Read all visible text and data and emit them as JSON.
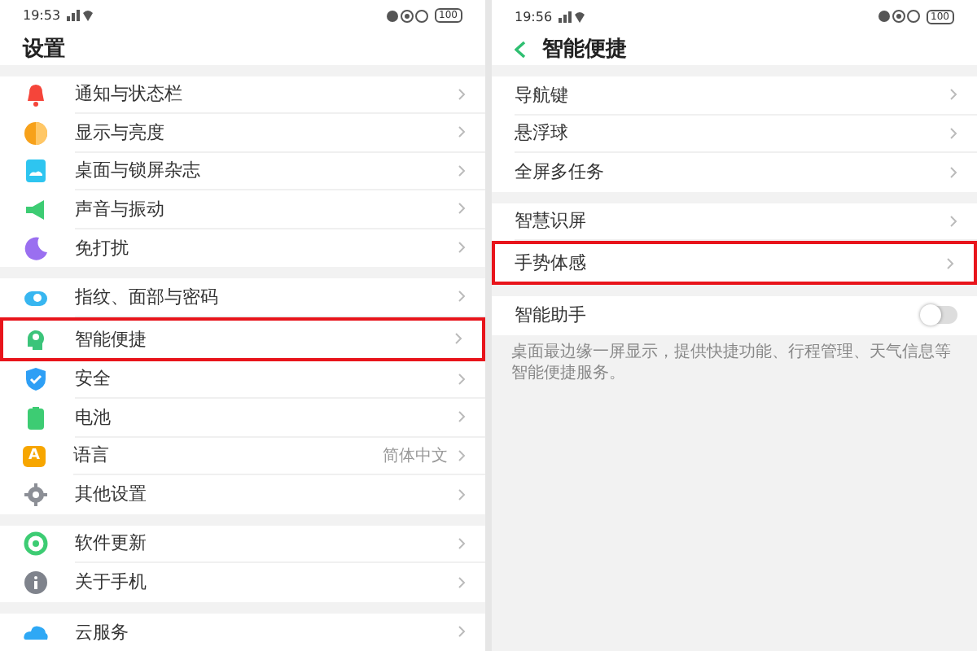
{
  "screens": [
    {
      "status_bar": {
        "time": "19:53",
        "battery": "100"
      },
      "title": "设置",
      "back": false,
      "groups": [
        {
          "items": [
            {
              "kind": "icon-row",
              "label": "通知与状态栏",
              "highlighted": false
            },
            {
              "kind": "icon-row",
              "label": "显示与亮度",
              "highlighted": false
            },
            {
              "kind": "icon-row",
              "label": "桌面与锁屏杂志",
              "highlighted": false
            },
            {
              "kind": "icon-row",
              "label": "声音与振动",
              "highlighted": false
            },
            {
              "kind": "icon-row",
              "label": "免打扰",
              "highlighted": false
            }
          ]
        },
        {
          "items": [
            {
              "kind": "icon-row",
              "label": "指纹、面部与密码",
              "highlighted": false
            },
            {
              "kind": "icon-row",
              "label": "智能便捷",
              "highlighted": true
            },
            {
              "kind": "icon-row",
              "label": "安全",
              "highlighted": false
            },
            {
              "kind": "icon-row",
              "label": "电池",
              "highlighted": false
            },
            {
              "kind": "icon-row",
              "label": "语言",
              "highlighted": false,
              "badge": "A",
              "value": "简体中文"
            },
            {
              "kind": "icon-row",
              "label": "其他设置",
              "highlighted": false
            }
          ]
        },
        {
          "items": [
            {
              "kind": "icon-row",
              "label": "软件更新",
              "highlighted": false
            },
            {
              "kind": "icon-row",
              "label": "关于手机",
              "highlighted": false
            }
          ]
        },
        {
          "items": [
            {
              "kind": "icon-row",
              "label": "云服务",
              "highlighted": false
            }
          ]
        }
      ]
    },
    {
      "status_bar": {
        "time": "19:56",
        "battery": "100"
      },
      "title": "智能便捷",
      "back": true,
      "groups": [
        {
          "items": [
            {
              "kind": "row",
              "label": "导航键",
              "highlighted": false
            },
            {
              "kind": "row",
              "label": "悬浮球",
              "highlighted": false
            },
            {
              "kind": "row",
              "label": "全屏多任务",
              "highlighted": false
            }
          ]
        },
        {
          "items": [
            {
              "kind": "row",
              "label": "智慧识屏",
              "highlighted": false
            },
            {
              "kind": "row",
              "label": "手势体感",
              "highlighted": true
            }
          ]
        },
        {
          "items": [
            {
              "kind": "switch-row",
              "label": "智能助手",
              "highlighted": false,
              "on": false
            }
          ]
        }
      ],
      "note": "桌面最边缘一屏显示，提供快捷功能、行程管理、天气信息等智能便捷服务。"
    }
  ]
}
